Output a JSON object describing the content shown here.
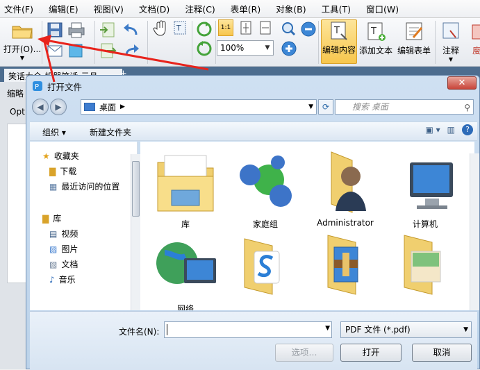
{
  "menu": [
    "文件(F)",
    "编辑(E)",
    "视图(V)",
    "文档(D)",
    "注释(C)",
    "表单(R)",
    "对象(B)",
    "工具(T)",
    "窗口(W)"
  ],
  "toolbar": {
    "open_label": "打开(O)...",
    "zoom_value": "100%",
    "zoom_buttons": [
      "1:1"
    ],
    "edit_content": "编辑内容",
    "add_text": "添加文本",
    "edit_form": "编辑表单",
    "annotate": "注释",
    "cut_off": "廋"
  },
  "doc_tab": {
    "title": "笑话大全-机器笑话-元旦"
  },
  "side_panel": {
    "tab": "缩略",
    "opt": "Opt"
  },
  "dialog": {
    "title": "打开文件",
    "close": "✕",
    "address": "桌面",
    "search_placeholder": "搜索 桌面",
    "organize": "组织 ▾",
    "new_folder": "新建文件夹",
    "nav": {
      "favorites": "收藏夹",
      "downloads": "下载",
      "recent": "最近访问的位置",
      "libraries": "库",
      "videos": "视频",
      "pictures": "图片",
      "documents": "文档",
      "music": "音乐"
    },
    "files": [
      "库",
      "家庭组",
      "Administrator",
      "计算机",
      "网络",
      "",
      "",
      ""
    ],
    "filename_label": "文件名(N):",
    "filename_value": "",
    "filter": "PDF 文件 (*.pdf)",
    "options_btn": "选项...",
    "open_btn": "打开",
    "cancel_btn": "取消"
  },
  "colors": {
    "accent": "#f7c64d",
    "arrow": "#e8231c",
    "dialog_frame": "#bcd3ea"
  }
}
